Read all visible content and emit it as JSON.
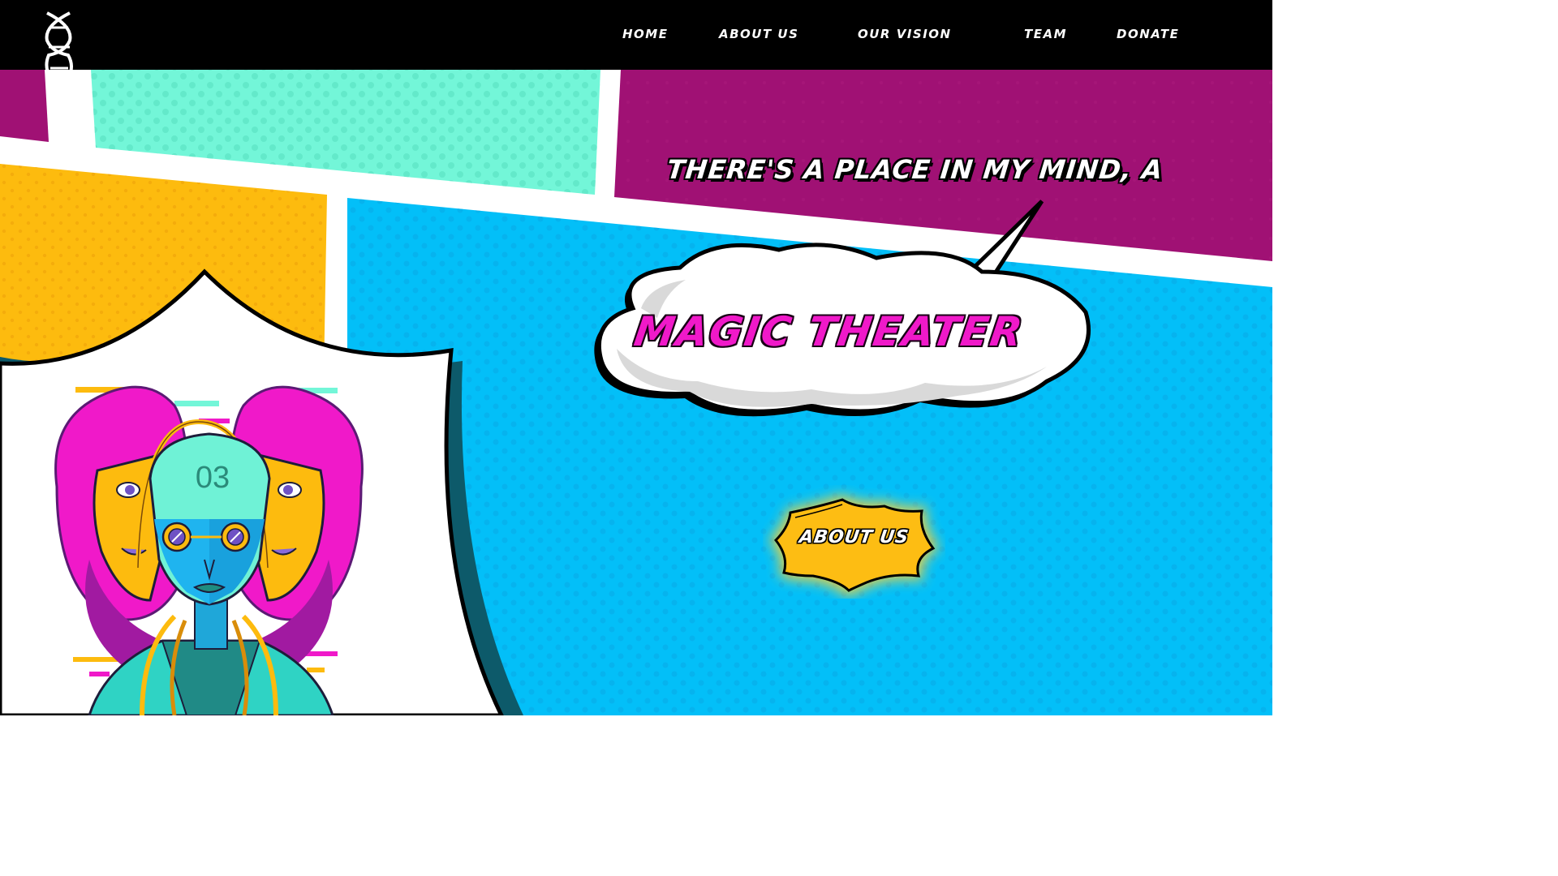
{
  "nav": {
    "logo_icon": "dna-helix-icon",
    "items": [
      {
        "label": "HOME"
      },
      {
        "label": "ABOUT US"
      },
      {
        "label": "OUR VISION"
      },
      {
        "label": "TEAM"
      },
      {
        "label": "DONATE"
      }
    ]
  },
  "hero": {
    "tagline": "THERE'S A PLACE IN MY MIND, A",
    "headline": "MAGIC THEATER",
    "cta_label": "ABOUT US",
    "illustration_badge": "03"
  },
  "colors": {
    "nav_bg": "#000000",
    "purple_panel": "#a01174",
    "mint_panel": "#73f6d8",
    "yellow_panel": "#fdbb0e",
    "blue_panel": "#03bff8",
    "headline_pink": "#f019c9",
    "cta_yellow": "#fdbd13"
  }
}
